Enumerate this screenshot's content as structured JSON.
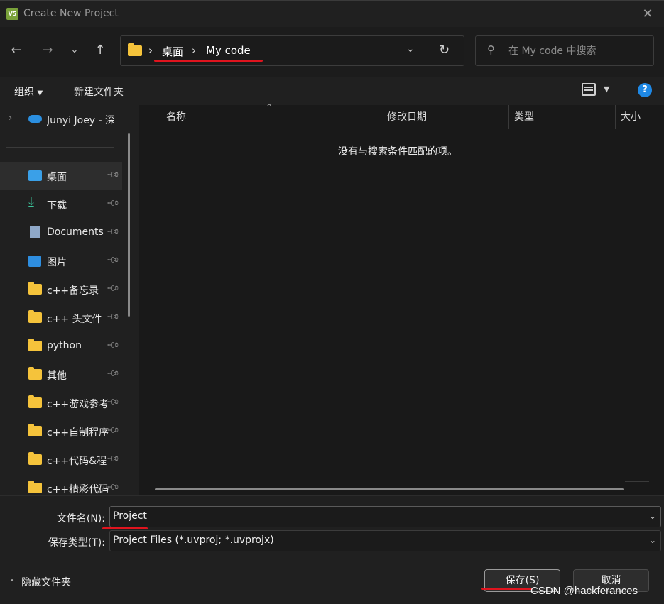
{
  "window": {
    "title": "Create New Project",
    "app_icon_text": "V5"
  },
  "nav": {
    "back_icon": "arrow-left-icon",
    "forward_icon": "arrow-right-icon",
    "recent_icon": "chevron-down-icon",
    "up_icon": "arrow-up-icon",
    "breadcrumbs": [
      "桌面",
      "My code"
    ],
    "search_placeholder": "在 My code 中搜索"
  },
  "toolbar": {
    "organize": "组织",
    "new_folder": "新建文件夹"
  },
  "sidebar": {
    "cloud_item": "Junyi Joey - 深",
    "items": [
      {
        "label": "桌面",
        "icon": "desktop-icon",
        "pinned": true
      },
      {
        "label": "下载",
        "icon": "download-icon",
        "pinned": true
      },
      {
        "label": "Documents",
        "icon": "document-icon",
        "pinned": true
      },
      {
        "label": "图片",
        "icon": "pictures-icon",
        "pinned": true
      },
      {
        "label": "c++备忘录",
        "icon": "folder-icon",
        "pinned": true
      },
      {
        "label": "c++ 头文件",
        "icon": "folder-icon",
        "pinned": true
      },
      {
        "label": "python",
        "icon": "folder-icon",
        "pinned": true
      },
      {
        "label": "其他",
        "icon": "folder-icon",
        "pinned": true
      },
      {
        "label": "c++游戏参考",
        "icon": "folder-icon",
        "pinned": true
      },
      {
        "label": "c++自制程序",
        "icon": "folder-icon",
        "pinned": true
      },
      {
        "label": "c++代码&程",
        "icon": "folder-icon",
        "pinned": true
      },
      {
        "label": "c++精彩代码",
        "icon": "folder-icon",
        "pinned": true
      }
    ]
  },
  "columns": [
    "名称",
    "修改日期",
    "类型",
    "大小"
  ],
  "empty_message": "没有与搜索条件匹配的项。",
  "form": {
    "filename_label": "文件名(N):",
    "filename_value": "Project",
    "filetype_label": "保存类型(T):",
    "filetype_value": "Project Files (*.uvproj; *.uvprojx)"
  },
  "footer": {
    "hide_folders": "隐藏文件夹",
    "save": "保存(S)",
    "cancel": "取消",
    "watermark": "CSDN @hackferances"
  },
  "colors": {
    "annotation_red": "#e0141e",
    "folder_yellow": "#f5c33b",
    "help_blue": "#1e88e5"
  }
}
